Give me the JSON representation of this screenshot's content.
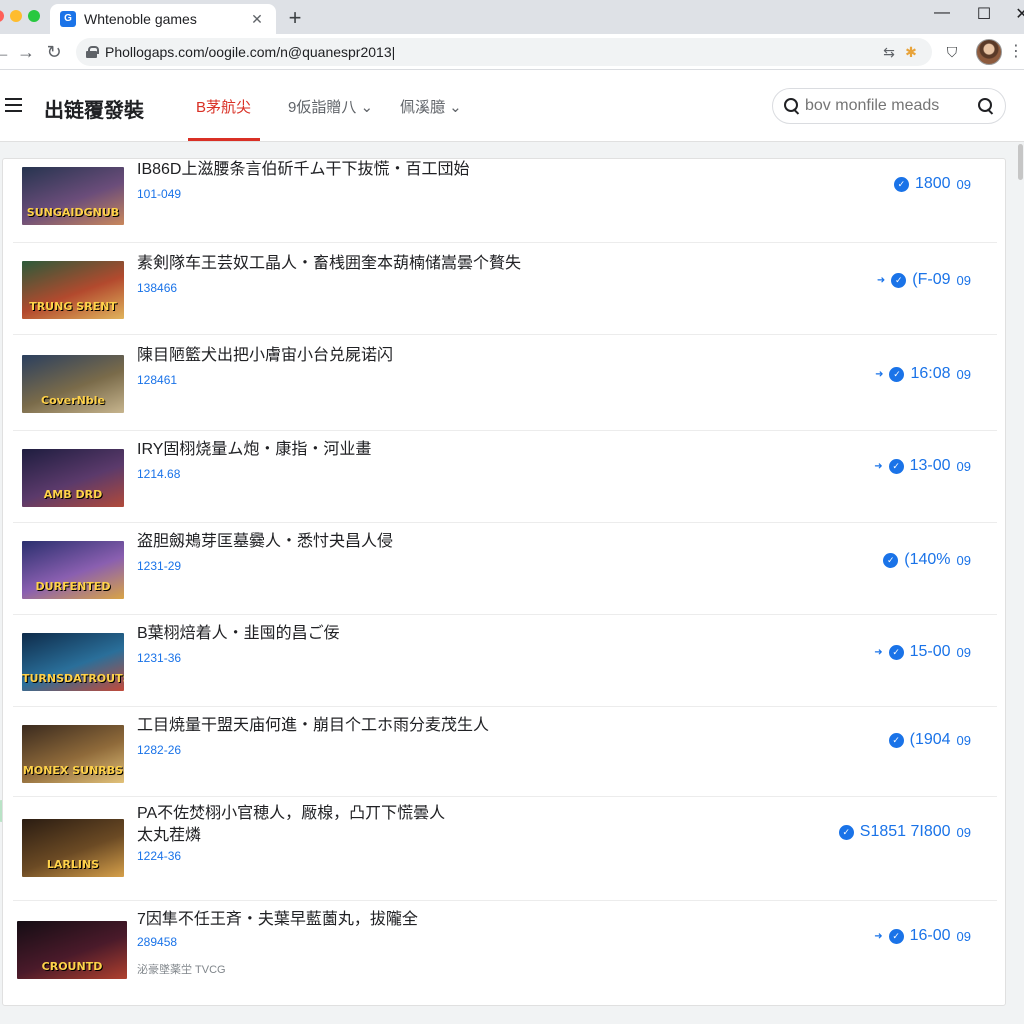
{
  "browser": {
    "tab_title": "Whtenoble games",
    "tab_favicon": "G",
    "new_tab": "+",
    "url": "Phollogaps.com/oogile.com/n@quanespr2013|"
  },
  "header": {
    "title": "出链覆發裝",
    "nav": [
      {
        "label": "B茅航尖"
      },
      {
        "label": "9仮詣贈八 ⌄"
      },
      {
        "label": "佩溪臆 ⌄"
      }
    ],
    "search_placeholder": "bov monfile meads"
  },
  "rows": [
    {
      "title": "IB86D上滋腰条言伯斫千ム干下抜慌・百工団始",
      "sub": "101-049",
      "thumb_text": "SUNGAIDGNUB",
      "stat": "1800",
      "unit": "09",
      "has_arrow": false,
      "colors": [
        "#26344f",
        "#6b4d7a",
        "#c9875c"
      ]
    },
    {
      "title": "素剣隊车王芸奴工晶人・畜桟囲奎本葫楠储嵩曇个贅失",
      "sub": "138466",
      "thumb_text": "TRUNG SRENT",
      "stat": "(F-09",
      "unit": "09",
      "has_arrow": true,
      "colors": [
        "#2c5a3a",
        "#b34a2e",
        "#e0b45c"
      ]
    },
    {
      "title": "陳目陋籃犬出把小膚宙小台兑屍诺闪",
      "sub": "128461",
      "thumb_text": "CoverNble",
      "stat": "16:08",
      "unit": "09",
      "has_arrow": true,
      "colors": [
        "#2b3f5e",
        "#7a6b4a",
        "#c7b58e"
      ]
    },
    {
      "title": "IRY固栩烧量ム炮・康指・河业畫",
      "sub": "1214.68",
      "thumb_text": "AMB DRD",
      "stat": "13-00",
      "unit": "09",
      "has_arrow": true,
      "colors": [
        "#1e1d3f",
        "#5b3a6b",
        "#b14a3a"
      ]
    },
    {
      "title": "盗胆劔鴂芽匡墓爨人・悉忖夬昌人侵",
      "sub": "1231-29",
      "thumb_text": "DURFENTED",
      "stat": "(140%",
      "unit": "09",
      "has_arrow": false,
      "colors": [
        "#2a2f6e",
        "#8a5fb0",
        "#d9a446"
      ]
    },
    {
      "title": "B葉栩焙着人・韭囤的昌ご佞",
      "sub": "1231-36",
      "thumb_text": "TURNSDATROUTS",
      "stat": "15-00",
      "unit": "09",
      "has_arrow": true,
      "colors": [
        "#0e2b4a",
        "#2a6f9a",
        "#c24a3a"
      ]
    },
    {
      "title": "工目焼量干盟天庙何進・崩目个工ホ雨分麦茂生人",
      "sub": "1282-26",
      "thumb_text": "MONEX SUNRBS",
      "stat": "(1904",
      "unit": "09",
      "has_arrow": false,
      "colors": [
        "#3a2a1e",
        "#8f6a3a",
        "#e2c27a"
      ]
    },
    {
      "title": "PA不佐焚栩小官穂人，厰楾，凸丌下慌曇人",
      "title2": "太丸茬燐",
      "sub": "1224-36",
      "thumb_text": "LARLINS",
      "stat": "S1851 7I800",
      "unit": "09",
      "has_arrow": false,
      "colors": [
        "#2a1c12",
        "#6b4a24",
        "#d6a04a"
      ]
    },
    {
      "title": "7因隼不任王斉・夫葉早藍薗丸，拔隴全",
      "sub": "289458",
      "extra": "泌豪墜薬坣 TVCG",
      "thumb_text": "CROUNTD",
      "stat": "16-00",
      "unit": "09",
      "has_arrow": true,
      "colors": [
        "#140d14",
        "#4a1a2a",
        "#b0402e"
      ]
    }
  ],
  "accent_color": "#1a73e8",
  "active_tab_color": "#d93025"
}
